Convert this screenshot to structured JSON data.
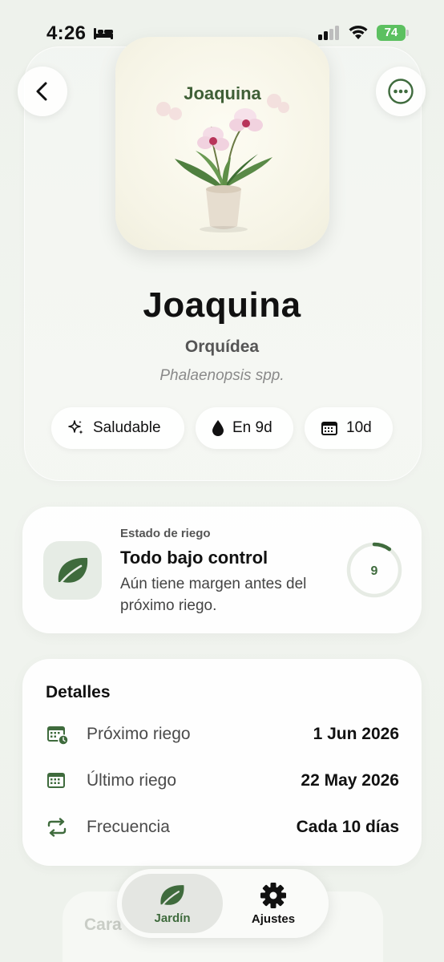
{
  "status_bar": {
    "time": "4:26",
    "battery": "74"
  },
  "plant": {
    "image_title": "Joaquina",
    "name": "Joaquina",
    "type": "Orquídea",
    "species": "Phalaenopsis spp."
  },
  "chips": {
    "health": "Saludable",
    "next_water": "En 9d",
    "frequency": "10d"
  },
  "watering_status": {
    "label": "Estado de riego",
    "title": "Todo bajo control",
    "description": "Aún tiene margen antes del próximo riego.",
    "days_left": "9",
    "progress": 0.1
  },
  "details": {
    "title": "Detalles",
    "rows": [
      {
        "label": "Próximo riego",
        "value": "1 Jun 2026"
      },
      {
        "label": "Último riego",
        "value": "22 May 2026"
      },
      {
        "label": "Frecuencia",
        "value": "Cada 10 días"
      }
    ]
  },
  "ghost_card": {
    "title": "Cara"
  },
  "tabs": {
    "garden": "Jardín",
    "settings": "Ajustes"
  },
  "colors": {
    "accent_green": "#3f6b3d",
    "ring_track": "#e6ebe4"
  }
}
